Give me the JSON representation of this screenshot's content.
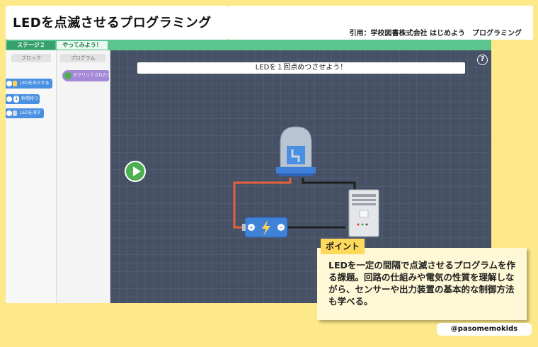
{
  "header": {
    "title": "LEDを点滅させるプログラミング",
    "citation": "引用：学校図書株式会社 はじめよう　プログラミング"
  },
  "app": {
    "tabs": [
      {
        "label": "ステージ２"
      },
      {
        "label": "やってみよう！"
      }
    ],
    "palette": {
      "header": "ブロック",
      "blocks": [
        {
          "label": "LEDを光らせる"
        },
        {
          "label": "秒間待つ",
          "value": "1"
        },
        {
          "label": "LEDを消す"
        }
      ]
    },
    "program": {
      "header": "プログラム",
      "start_block": "がクリックされたとき"
    },
    "stage": {
      "instruction": "LEDを１回点めつさせよう！",
      "help": "?"
    }
  },
  "point": {
    "label": "ポイント",
    "text": "LEDを一定の間隔で点滅させるプログラムを作る課題。回路の仕組みや電気の性質を理解しながら、センサーや出力装置の基本的な制御方法も学べる。"
  },
  "handle": "@pasomemokids",
  "colors": {
    "background": "#fde98a",
    "stage": "#465166",
    "tab_bar": "#5cc48f",
    "block": "#4a90e2",
    "start_block": "#a489d6",
    "point_label": "#ffd95a"
  },
  "icons": [
    "help-icon",
    "play-icon",
    "led-icon",
    "battery-icon",
    "controller-icon",
    "flag-icon"
  ]
}
